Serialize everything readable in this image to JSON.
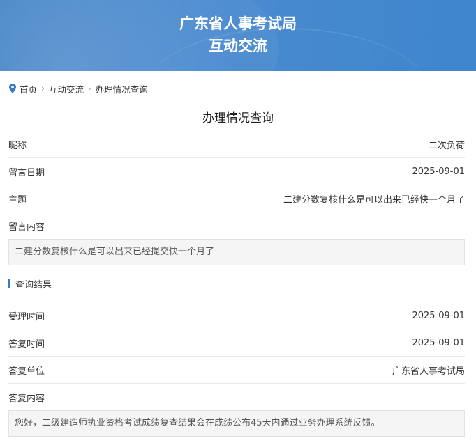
{
  "banner": {
    "line1": "广东省人事考试局",
    "line2": "互动交流"
  },
  "breadcrumb": {
    "home": "首页",
    "section": "互动交流",
    "current": "办理情况查询",
    "separator": "›"
  },
  "page_title": "办理情况查询",
  "message": {
    "nickname_label": "昵称",
    "nickname": "二次负荷",
    "date_label": "留言日期",
    "date": "2025-09-01",
    "subject_label": "主题",
    "subject": "二建分数复核什么是可以出来已经快一个月了",
    "content_label": "留言内容",
    "content": "二建分数复核什么是可以出来已经提交快一个月了"
  },
  "result": {
    "section_title": "查询结果",
    "accept_time_label": "受理时间",
    "accept_time": "2025-09-01",
    "reply_time_label": "答复时间",
    "reply_time": "2025-09-01",
    "reply_unit_label": "答复单位",
    "reply_unit": "广东省人事考试局",
    "reply_content_label": "答复内容",
    "reply_content": "您好，二级建造师执业资格考试成绩复查结果会在成绩公布45天内通过业务办理系统反馈。"
  },
  "colors": {
    "banner": "#4a8ad0",
    "accent": "#3b78c8"
  }
}
